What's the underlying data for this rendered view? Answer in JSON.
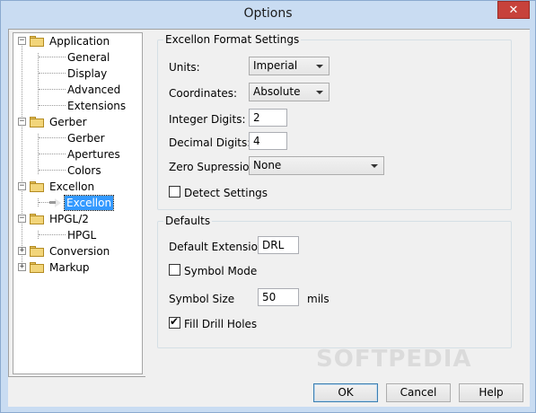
{
  "window": {
    "title": "Options",
    "close_label": "✕"
  },
  "tree": {
    "nodes": [
      {
        "label": "Application",
        "expander": "−"
      },
      {
        "label": "General"
      },
      {
        "label": "Display"
      },
      {
        "label": "Advanced"
      },
      {
        "label": "Extensions"
      },
      {
        "label": "Gerber",
        "expander": "−"
      },
      {
        "label": "Gerber"
      },
      {
        "label": "Apertures"
      },
      {
        "label": "Colors"
      },
      {
        "label": "Excellon",
        "expander": "−"
      },
      {
        "label": "Excellon",
        "selected": true
      },
      {
        "label": "HPGL/2",
        "expander": "−"
      },
      {
        "label": "HPGL"
      },
      {
        "label": "Conversion",
        "expander": "+"
      },
      {
        "label": "Markup",
        "expander": "+"
      }
    ]
  },
  "format": {
    "title": "Excellon Format Settings",
    "units_label": "Units:",
    "units_value": "Imperial",
    "coordinates_label": "Coordinates:",
    "coordinates_value": "Absolute",
    "integer_label": "Integer Digits:",
    "integer_value": "2",
    "decimal_label": "Decimal Digits:",
    "decimal_value": "4",
    "zero_label": "Zero Supression:",
    "zero_value": "None",
    "detect_label": "Detect Settings",
    "detect_checked": false
  },
  "defaults": {
    "title": "Defaults",
    "ext_label": "Default Extension",
    "ext_value": "DRL",
    "symbol_mode_label": "Symbol Mode",
    "symbol_mode_checked": false,
    "symbol_size_label": "Symbol Size",
    "symbol_size_value": "50",
    "symbol_size_unit": "mils",
    "fill_label": "Fill  Drill Holes",
    "fill_checked": true
  },
  "buttons": {
    "ok": "OK",
    "cancel": "Cancel",
    "help": "Help"
  },
  "watermark": "SOFTPEDIA"
}
